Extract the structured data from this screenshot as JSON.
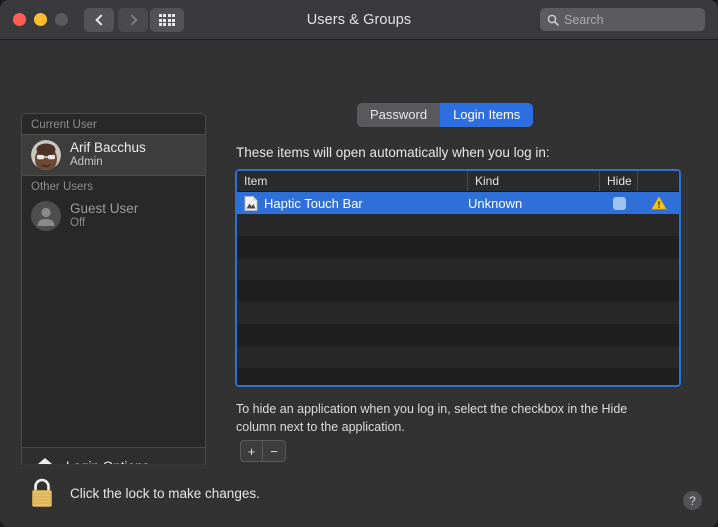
{
  "window": {
    "title": "Users & Groups",
    "traffic_lights": [
      "close",
      "minimize",
      "maximize"
    ]
  },
  "toolbar": {
    "back_label": "‹",
    "forward_label": "›",
    "show_all_label": "Show All",
    "search_placeholder": "Search"
  },
  "sidebar": {
    "groups": [
      {
        "header": "Current User",
        "users": [
          {
            "name": "Arif Bacchus",
            "status": "Admin",
            "selected": true,
            "avatar": "photo-avatar"
          }
        ]
      },
      {
        "header": "Other Users",
        "users": [
          {
            "name": "Guest User",
            "status": "Off",
            "selected": false,
            "avatar": "person-silhouette"
          }
        ]
      }
    ],
    "login_options_label": "Login Options",
    "add_label": "+",
    "remove_label": "−"
  },
  "main": {
    "tabs": [
      {
        "label": "Password",
        "active": false
      },
      {
        "label": "Login Items",
        "active": true
      }
    ],
    "note": "These items will open automatically when you log in:",
    "table": {
      "columns": [
        "Item",
        "Kind",
        "Hide",
        ""
      ],
      "rows": [
        {
          "item": "Haptic Touch Bar",
          "kind": "Unknown",
          "hide_checked": false,
          "warning": true,
          "selected": true,
          "icon": "document-file-icon"
        }
      ],
      "empty_row_count": 8
    },
    "hint": "To hide an application when you log in, select the checkbox in the Hide column next to the application.",
    "add_label": "+",
    "remove_label": "−"
  },
  "footer": {
    "lock_text": "Click the lock to make changes.",
    "lock_state": "locked",
    "help_label": "?"
  },
  "colors": {
    "accent_blue": "#2f6fd8",
    "tab_active": "#2d6fe0",
    "warning_yellow": "#f0c419",
    "lock_gold": "#e8c06a",
    "window_bg": "#323232",
    "sidebar_bg": "#282828"
  }
}
